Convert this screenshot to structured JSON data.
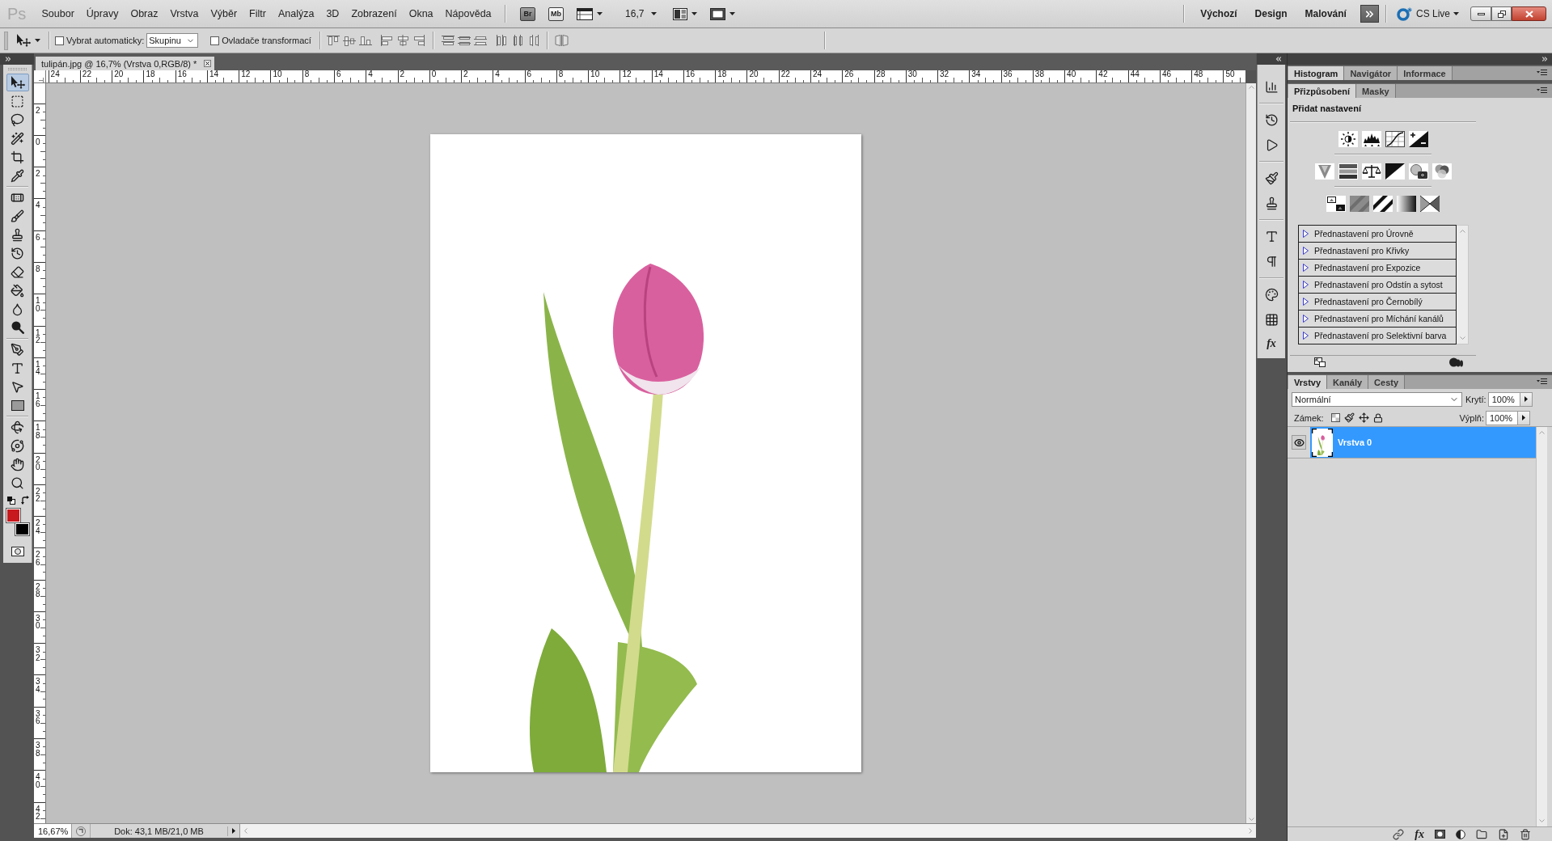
{
  "app_bar": {
    "logo": "Ps",
    "menus": [
      "Soubor",
      "Úpravy",
      "Obraz",
      "Vrstva",
      "Výběr",
      "Filtr",
      "Analýza",
      "3D",
      "Zobrazení",
      "Okna",
      "Nápověda"
    ],
    "launchers": [
      {
        "label": "Br",
        "kind": "filled"
      },
      {
        "label": "Mb",
        "kind": "outlined"
      }
    ],
    "zoom": "16,7",
    "workspaces": [
      "Výchozí",
      "Design",
      "Malování"
    ],
    "cs_live": "CS Live"
  },
  "options_bar": {
    "auto_select": {
      "label": "Vybrat automaticky:",
      "checked": false
    },
    "auto_select_target": "Skupinu",
    "transform_controls": {
      "label": "Ovladače transformací",
      "checked": false
    }
  },
  "tools": {
    "groups": [
      [
        {
          "kind": "move",
          "selected": true
        },
        {
          "kind": "marquee",
          "selected": false
        },
        {
          "kind": "lasso",
          "selected": false
        },
        {
          "kind": "magic_wand",
          "selected": false
        },
        {
          "kind": "crop",
          "selected": false
        },
        {
          "kind": "eyedropper",
          "selected": false
        }
      ],
      [
        {
          "kind": "healing",
          "selected": false
        },
        {
          "kind": "brush",
          "selected": false
        },
        {
          "kind": "stamp",
          "selected": false
        },
        {
          "kind": "history_brush",
          "selected": false
        },
        {
          "kind": "eraser",
          "selected": false
        },
        {
          "kind": "paint_bucket",
          "selected": false
        },
        {
          "kind": "blur",
          "selected": false
        },
        {
          "kind": "dodge",
          "selected": false
        }
      ],
      [
        {
          "kind": "pen",
          "selected": false
        },
        {
          "kind": "type",
          "selected": false
        },
        {
          "kind": "path_selection",
          "selected": false
        },
        {
          "kind": "shape",
          "selected": false
        }
      ],
      [
        {
          "kind": "rotate_3d",
          "selected": false
        },
        {
          "kind": "orbit_3d",
          "selected": false
        },
        {
          "kind": "hand",
          "selected": false
        },
        {
          "kind": "zoom",
          "selected": false
        }
      ]
    ],
    "color_swatches": [
      {
        "kind": "foreground",
        "color": "#c8191e"
      },
      {
        "kind": "background",
        "color": "#000000"
      }
    ]
  },
  "document": {
    "tab_title": "tulipán.jpg @ 16,7% (Vrstva 0,RGB/8) *",
    "ruler_horizontal": [
      "24",
      "22",
      "20",
      "18",
      "16",
      "14",
      "12",
      "10",
      "8",
      "6",
      "4",
      "2",
      "0",
      "2",
      "4",
      "6",
      "8",
      "10",
      "12",
      "14",
      "16",
      "18",
      "20",
      "22",
      "24",
      "26",
      "28",
      "30",
      "32",
      "34",
      "36",
      "38",
      "40",
      "42",
      "44",
      "46",
      "48",
      "50"
    ],
    "ruler_vertical": [
      "2",
      "0",
      "2",
      "4",
      "6",
      "8",
      "10",
      "12",
      "14",
      "16",
      "18",
      "20",
      "22",
      "24",
      "26",
      "28",
      "30",
      "32",
      "34",
      "36",
      "38",
      "40",
      "42"
    ],
    "status_zoom": "16,67%",
    "status_info": "Dok: 43,1 MB/21,0 MB"
  },
  "dock": {
    "styles_button": "fx"
  },
  "panels": {
    "top_tabs": [
      {
        "label": "Histogram",
        "selected": true
      },
      {
        "label": "Navigátor",
        "selected": false
      },
      {
        "label": "Informace",
        "selected": false
      }
    ],
    "adjust_tabs": [
      {
        "label": "Přizpůsobení",
        "selected": true
      },
      {
        "label": "Masky",
        "selected": false
      }
    ],
    "adjustments": {
      "heading": "Přidat nastavení",
      "presets": [
        {
          "label": "Přednastavení pro Úrovně",
          "expanded": false
        },
        {
          "label": "Přednastavení pro Křivky",
          "expanded": false
        },
        {
          "label": "Přednastavení pro Expozice",
          "expanded": false
        },
        {
          "label": "Přednastavení pro Odstín a sytost",
          "expanded": false
        },
        {
          "label": "Přednastavení pro Černobílý",
          "expanded": false
        },
        {
          "label": "Přednastavení pro Míchání kanálů",
          "expanded": false
        },
        {
          "label": "Přednastavení pro Selektivní barva",
          "expanded": false
        }
      ]
    },
    "layer_tabs": [
      {
        "label": "Vrstvy",
        "selected": true
      },
      {
        "label": "Kanály",
        "selected": false
      },
      {
        "label": "Cesty",
        "selected": false
      }
    ],
    "layers": {
      "blend_mode": "Normální",
      "opacity_label": "Krytí:",
      "opacity": "100%",
      "lock_label": "Zámek:",
      "fill_label": "Výplň:",
      "fill": "100%",
      "items": [
        {
          "name": "Vrstva 0",
          "visible": true,
          "selected": true
        }
      ],
      "effects_button": "fx"
    }
  }
}
